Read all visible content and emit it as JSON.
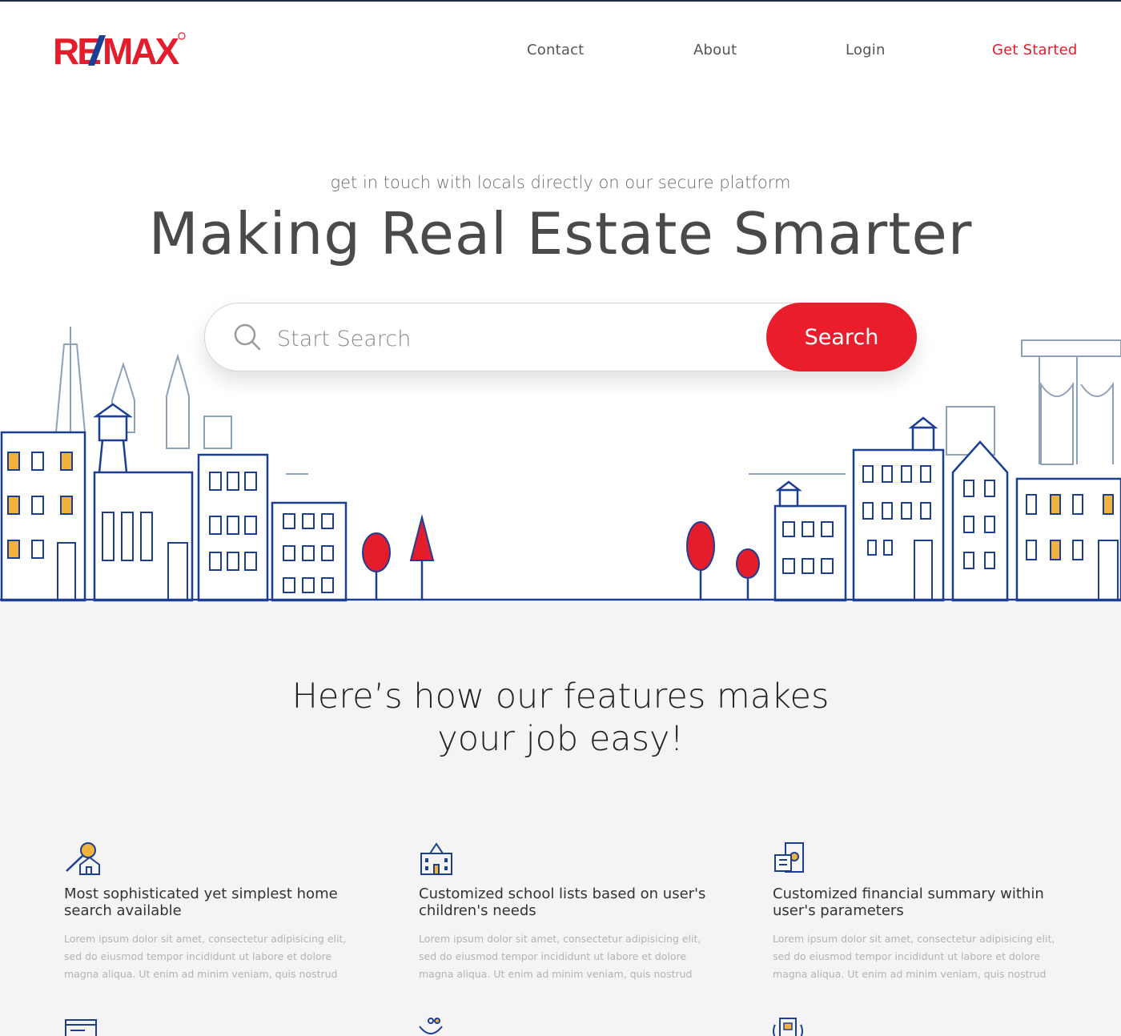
{
  "brand": {
    "name": "RE/MAX",
    "primary": "#ea1d2c",
    "secondary": "#1c3f94"
  },
  "nav": {
    "items": [
      {
        "label": "Contact"
      },
      {
        "label": "About"
      },
      {
        "label": "Login"
      },
      {
        "label": "Get Started"
      }
    ]
  },
  "hero": {
    "tagline": "get in touch with locals directly on our secure platform",
    "title": "Making Real Estate Smarter",
    "search": {
      "placeholder": "Start Search",
      "button_label": "Search",
      "icon": "search-icon"
    }
  },
  "features": {
    "title": "Here’s how our features makes\nyour job easy!",
    "items": [
      {
        "icon": "home-search-icon",
        "title": "Most sophisticated yet simplest home search available",
        "body": "Lorem ipsum dolor sit amet, consectetur adipisicing elit, sed do eiusmod tempor incididunt ut labore et dolore magna aliqua. Ut enim ad minim veniam, quis nostrud"
      },
      {
        "icon": "school-icon",
        "title": "Customized school lists based on user's children's needs",
        "body": "Lorem ipsum dolor sit amet, consectetur adipisicing elit, sed do eiusmod tempor incididunt ut labore et dolore magna aliqua. Ut enim ad minim veniam, quis nostrud"
      },
      {
        "icon": "financial-summary-icon",
        "title": "Customized financial summary within user's parameters",
        "body": "Lorem ipsum dolor sit amet, consectetur adipisicing elit, sed do eiusmod tempor incididunt ut labore et dolore magna aliqua. Ut enim ad minim veniam, quis nostrud"
      }
    ],
    "more_icons": [
      "browser-window-icon",
      "community-icon",
      "mobile-device-icon"
    ]
  },
  "colors": {
    "text_dark": "#4a4a4a",
    "section_bg": "#f4f4f4",
    "accent_yellow": "#f2b33d",
    "line_blue": "#1c3f94",
    "line_grey": "#8fa1b8"
  }
}
